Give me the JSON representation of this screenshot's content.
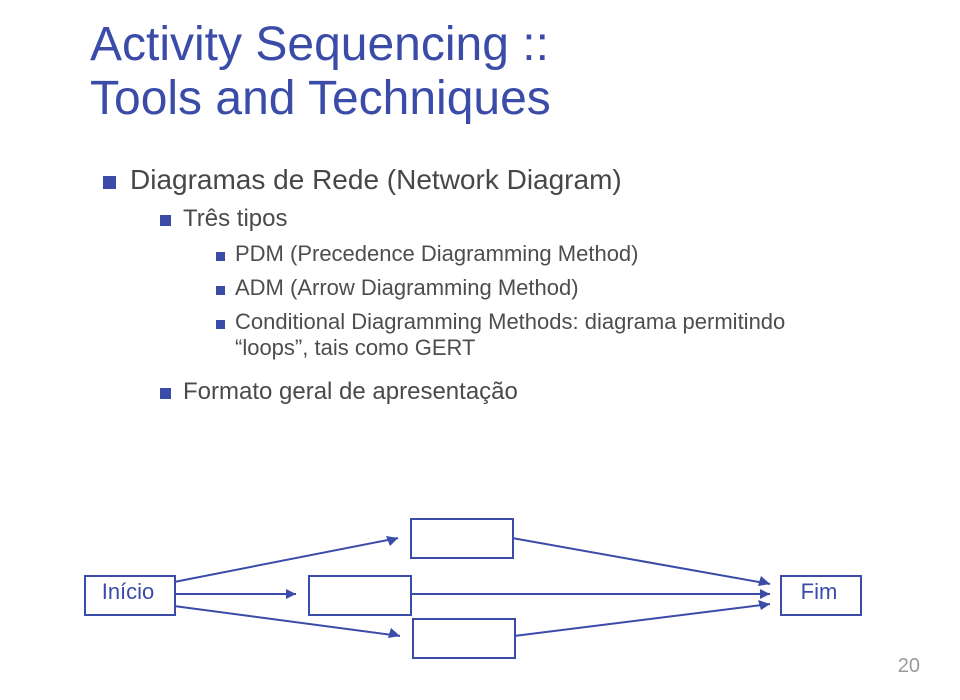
{
  "title": {
    "line1": "Activity Sequencing ::",
    "line2": "Tools and Techniques"
  },
  "bullets": {
    "l1_a": "Diagramas de Rede (Network Diagram)",
    "l2_a": "Três tipos",
    "l3_a": "PDM (Precedence Diagramming Method)",
    "l3_b": "ADM (Arrow Diagramming Method)",
    "l3_c": "Conditional Diagramming Methods: diagrama permitindo “loops”, tais como GERT",
    "l2_b": "Formato geral de apresentação"
  },
  "diagram": {
    "start": "Início",
    "end": "Fim"
  },
  "page_number": "20"
}
